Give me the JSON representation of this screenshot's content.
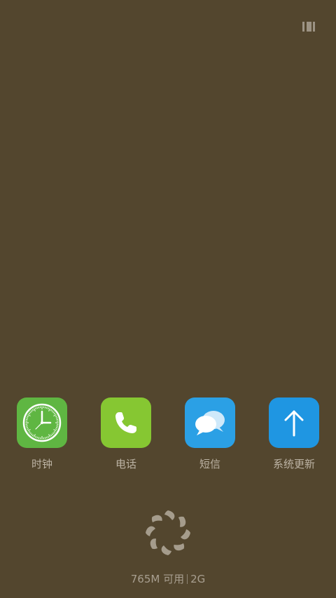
{
  "status": {
    "recents_icon": "recents-icon"
  },
  "recent_apps": [
    {
      "label": "时钟",
      "icon": "clock-icon",
      "color": "#5fb642"
    },
    {
      "label": "电话",
      "icon": "phone-icon",
      "color": "#86c732"
    },
    {
      "label": "短信",
      "icon": "messages-icon",
      "color": "#2ba0e5"
    },
    {
      "label": "系统更新",
      "icon": "update-arrow-icon",
      "color": "#1f96e2"
    }
  ],
  "clear_button": {
    "icon": "clean-spinner-icon"
  },
  "memory": {
    "available": "765M 可用",
    "total": "2G"
  }
}
